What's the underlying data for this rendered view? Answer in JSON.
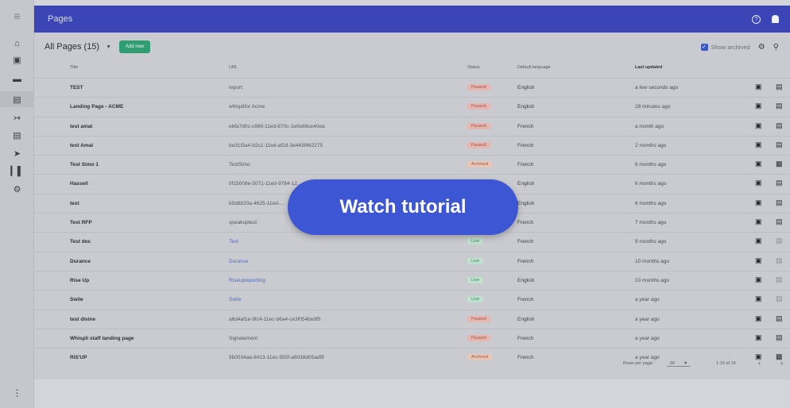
{
  "topbar": {
    "title": "Pages",
    "help_icon": "help-circle-icon",
    "bell_icon": "bell-icon"
  },
  "rail": {
    "icons": [
      "menu-icon",
      "home-icon",
      "save-icon",
      "folder-icon",
      "image-icon",
      "forward-icon",
      "clipboard-icon",
      "flash-icon",
      "bar-chart-icon",
      "gear-icon",
      "more-vert-icon"
    ]
  },
  "toolbar": {
    "all_pages": "All Pages (15)",
    "add_new": "Add new",
    "show_archived": "Show archived"
  },
  "table": {
    "headers": {
      "title": "Title",
      "url": "URL",
      "status": "Status",
      "language": "Default language",
      "updated": "Last updated"
    },
    "rows": [
      {
        "title": "TEST",
        "url": "report",
        "link": false,
        "status": "Paused",
        "language": "English",
        "updated": "a few seconds ago"
      },
      {
        "title": "Landing Page - ACME",
        "url": "whisplifor Acme",
        "link": false,
        "status": "Paused",
        "language": "English",
        "updated": "28 minutes ago"
      },
      {
        "title": "test amal",
        "url": "ebfa7d0c-c986-11ed-870c-1e0e69ce40ea",
        "link": false,
        "status": "Paused",
        "language": "French",
        "updated": "a month ago"
      },
      {
        "title": "test Amal",
        "url": "be31f3a4-b2c1-11ed-af2d-3e443f462275",
        "link": false,
        "status": "Paused",
        "language": "French",
        "updated": "2 months ago"
      },
      {
        "title": "Test Simo 1",
        "url": "TestSimo",
        "link": false,
        "status": "Archived",
        "language": "French",
        "updated": "6 months ago"
      },
      {
        "title": "Hassell",
        "url": "0f15009e-5071-11ed-9784-12...",
        "link": false,
        "status": "",
        "language": "English",
        "updated": "6 months ago"
      },
      {
        "title": "test",
        "url": "b5d8b20a-4625-11ed-...",
        "link": false,
        "status": "",
        "language": "English",
        "updated": "6 months ago"
      },
      {
        "title": "Test RFP",
        "url": "speakuptest",
        "link": false,
        "status": "",
        "language": "French",
        "updated": "7 months ago"
      },
      {
        "title": "Test doc",
        "url": "Test",
        "link": true,
        "status": "Live",
        "language": "French",
        "updated": "9 months ago"
      },
      {
        "title": "Durance",
        "url": "Durance",
        "link": true,
        "status": "Live",
        "language": "French",
        "updated": "10 months ago"
      },
      {
        "title": "Rise Up",
        "url": "Riseupreporting",
        "link": true,
        "status": "Live",
        "language": "English",
        "updated": "10 months ago"
      },
      {
        "title": "Swile",
        "url": "Swile",
        "link": true,
        "status": "Live",
        "language": "French",
        "updated": "a year ago"
      },
      {
        "title": "test divine",
        "url": "a6d4af1e-9fc4-11ec-b6a4-ce3f054be9f5",
        "link": false,
        "status": "Paused",
        "language": "English",
        "updated": "a year ago"
      },
      {
        "title": "Whispli staff landing page",
        "url": "Signalement",
        "link": false,
        "status": "Paused",
        "language": "French",
        "updated": "a year ago"
      },
      {
        "title": "RIS'UP",
        "url": "9b0034aa-8413-11ec-955f-a6038d05adf9",
        "link": false,
        "status": "Archived",
        "language": "French",
        "updated": "a year ago"
      }
    ]
  },
  "footer": {
    "rows_per_page_label": "Rows per page:",
    "rows_per_page_value": "50",
    "range": "1-15 of 15"
  },
  "overlay": {
    "tutorial_label": "Watch tutorial"
  }
}
